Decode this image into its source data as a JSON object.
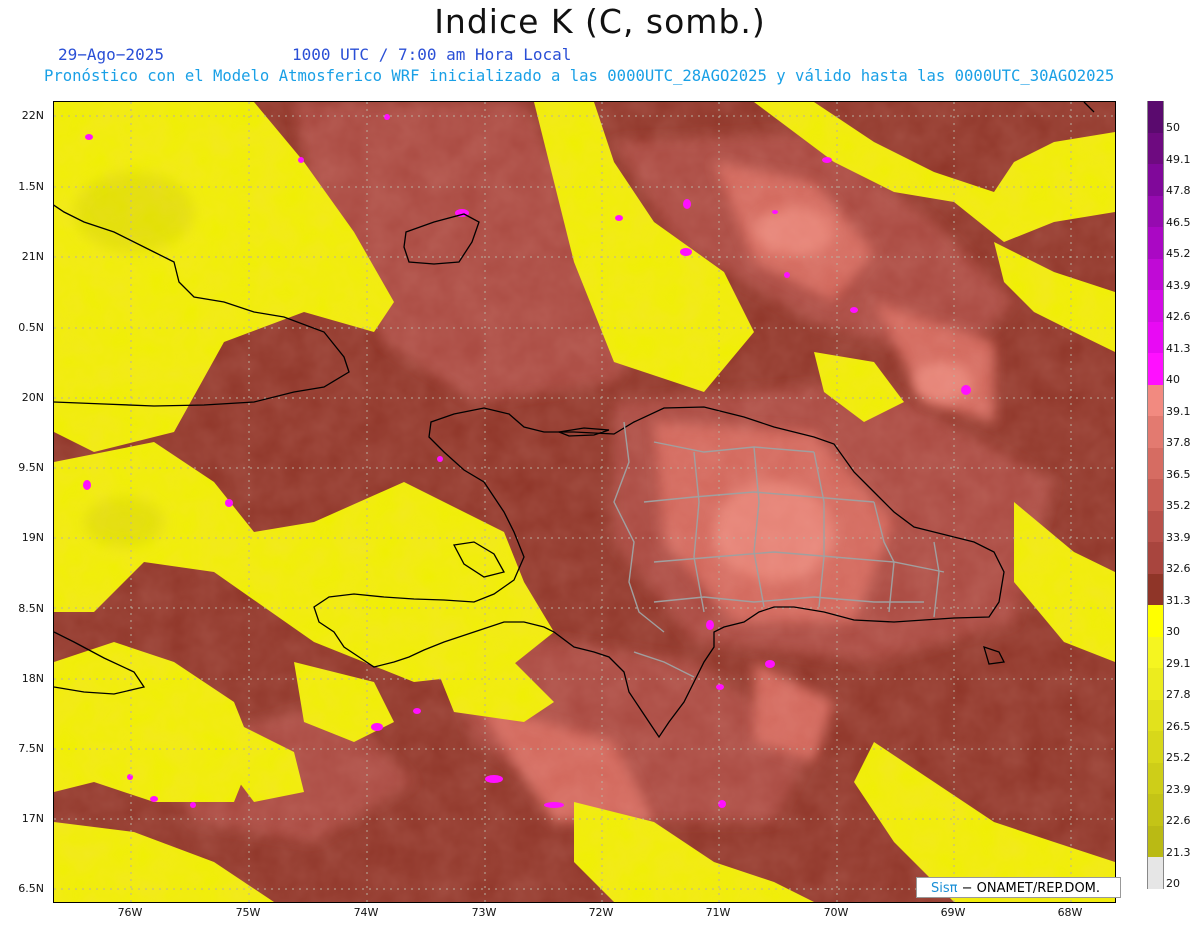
{
  "header": {
    "title": "Indice K (C, somb.)",
    "date": "29−Ago−2025",
    "time": "1000 UTC / 7:00 am Hora Local",
    "run_info": "Pronóstico con el Modelo Atmosferico WRF inicializado a las 0000UTC_28AGO2025 y válido hasta las  0000UTC_30AGO2025"
  },
  "map": {
    "lat_labels": [
      "22N",
      "1.5N",
      "21N",
      "0.5N",
      "20N",
      "9.5N",
      "19N",
      "8.5N",
      "18N",
      "7.5N",
      "17N",
      "6.5N"
    ],
    "lon_labels": [
      "76W",
      "75W",
      "74W",
      "73W",
      "72W",
      "71W",
      "70W",
      "69W",
      "68W"
    ]
  },
  "colorbar": {
    "values": [
      "50",
      "49.1",
      "47.8",
      "46.5",
      "45.2",
      "43.9",
      "42.6",
      "41.3",
      "40",
      "39.1",
      "37.8",
      "36.5",
      "35.2",
      "33.9",
      "32.6",
      "31.3",
      "30",
      "29.1",
      "27.8",
      "26.5",
      "25.2",
      "23.9",
      "22.6",
      "21.3",
      "20"
    ],
    "colors": [
      "#5a0a6e",
      "#6e0a80",
      "#80089a",
      "#960ab0",
      "#aa08c4",
      "#c00ad6",
      "#d40ae6",
      "#e80af4",
      "#ff10ff",
      "#f28a80",
      "#e37a70",
      "#d66c62",
      "#c85e55",
      "#b8514a",
      "#a8453e",
      "#8f3528",
      "#ffff00",
      "#f5f520",
      "#ecec1e",
      "#e2e21c",
      "#d8d81a",
      "#cece18",
      "#c4c416",
      "#baba14",
      "#e6e6e6"
    ]
  },
  "credit": {
    "logo": "Sisπ",
    "text": "− ONAMET/REP.DOM."
  }
}
